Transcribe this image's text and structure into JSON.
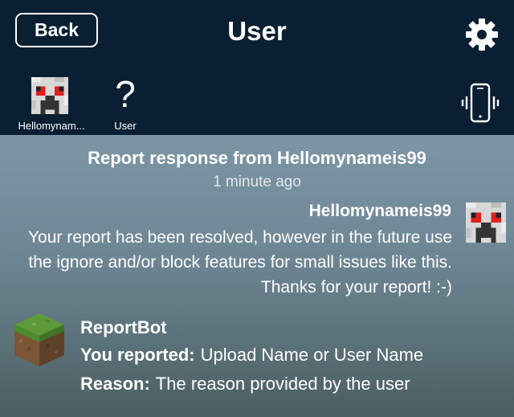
{
  "header": {
    "back_label": "Back",
    "title": "User",
    "settings_icon": "gear-icon",
    "device_icon": "phone-vibrate-icon"
  },
  "tabs": [
    {
      "label": "Hellomynam...",
      "icon": "creeper-avatar-icon"
    },
    {
      "label": "User",
      "icon": "question-mark-icon"
    }
  ],
  "message": {
    "title": "Report response from Hellomynameis99",
    "time": "1 minute ago",
    "author": "Hellomynameis99",
    "body": "Your report has been resolved, however in the future use the ignore and/or block features for small issues like this. Thanks for your report! :-)"
  },
  "report": {
    "bot_name": "ReportBot",
    "reported_label": "You reported:",
    "reported_value": "Upload Name or User Name",
    "reason_label": "Reason:",
    "reason_value": "The reason provided by the user"
  },
  "colors": {
    "header_bg": "#0b1f33",
    "content_bg_top": "#7d96a5",
    "content_bg_bottom": "#4b5e60",
    "text": "#ffffff"
  }
}
